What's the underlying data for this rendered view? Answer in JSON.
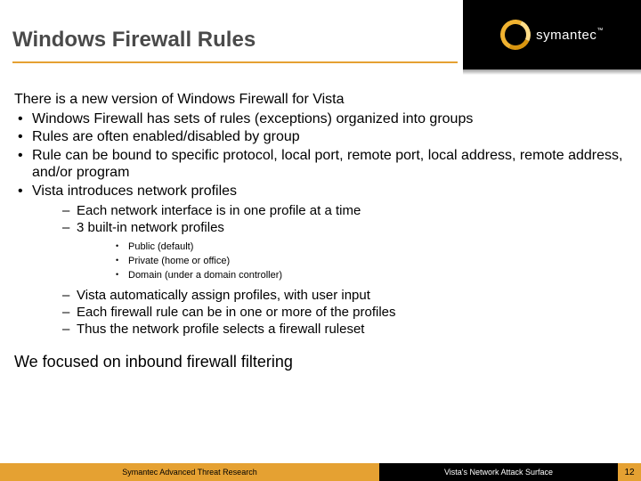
{
  "header": {
    "title": "Windows Firewall Rules",
    "brand": "symantec",
    "tm": "™"
  },
  "content": {
    "intro": "There is a new version of Windows Firewall for Vista",
    "bullets": [
      "Windows Firewall has sets of rules (exceptions) organized into groups",
      "Rules are often enabled/disabled by group",
      "Rule can be bound to specific protocol, local port, remote port, local address, remote address, and/or program",
      "Vista introduces network profiles"
    ],
    "sub_a": [
      "Each network interface is in one profile at a time",
      "3 built-in network profiles"
    ],
    "sub_b": [
      "Public (default)",
      "Private (home or office)",
      "Domain (under a domain controller)"
    ],
    "sub_c": [
      "Vista automatically assign profiles, with user input",
      "Each firewall rule can be in one or more of the profiles",
      "Thus the network profile selects a firewall ruleset"
    ],
    "closing": "We focused on inbound firewall filtering"
  },
  "footer": {
    "left": "Symantec Advanced Threat Research",
    "right": "Vista's Network Attack Surface",
    "page": "12"
  }
}
